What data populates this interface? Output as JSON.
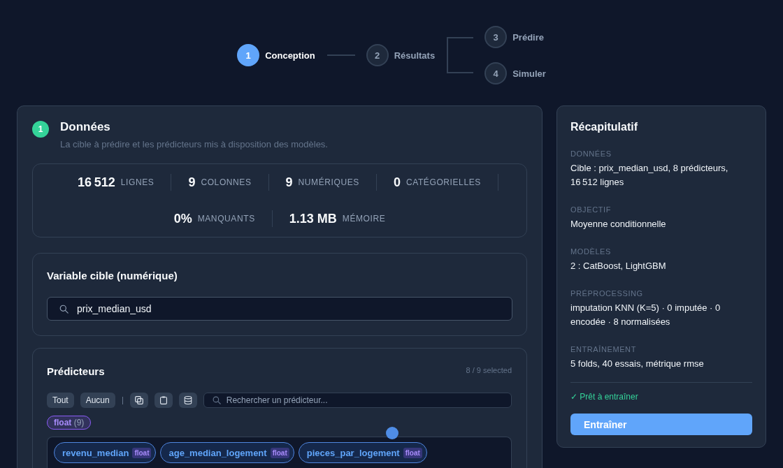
{
  "stepper": {
    "steps": [
      {
        "number": "1",
        "label": "Conception",
        "selected": true
      },
      {
        "number": "2",
        "label": "Résultats",
        "selected": false
      }
    ],
    "branch_steps": [
      {
        "number": "3",
        "label": "Prédire",
        "selected": false
      },
      {
        "number": "4",
        "label": "Simuler",
        "selected": false
      }
    ]
  },
  "data_card": {
    "step": "1",
    "title": "Données",
    "subtitle": "La cible à prédire et les prédicteurs mis à disposition des modèles.",
    "stats": [
      {
        "value": "16 512",
        "label": "LIGNES"
      },
      {
        "value": "9",
        "label": "COLONNES"
      },
      {
        "value": "9",
        "label": "NUMÉRIQUES"
      },
      {
        "value": "0",
        "label": "CATÉGORIELLES"
      },
      {
        "value": "0%",
        "label": "MANQUANTS"
      },
      {
        "value": "1.13 MB",
        "label": "MÉMOIRE"
      }
    ],
    "target": {
      "title": "Variable cible (numérique)",
      "value": "prix_median_usd"
    },
    "predictors": {
      "title": "Prédicteurs",
      "count": "8 / 9 selected",
      "buttons": [
        "Tout",
        "Aucun"
      ],
      "search": {
        "placeholder": "Rechercher un prédicteur..."
      },
      "type_filters": [
        {
          "label": "float",
          "count": "(9)",
          "selected": true
        }
      ],
      "chips": [
        {
          "name": "revenu_median",
          "type": "float",
          "selected": true
        },
        {
          "name": "age_median_logement",
          "type": "float",
          "selected": true
        },
        {
          "name": "pieces_par_logement",
          "type": "float",
          "selected": true
        }
      ]
    }
  },
  "summary": {
    "title": "Récapitulatif",
    "sections": [
      {
        "label": "DONNÉES",
        "value": "Cible : prix_median_usd, 8 prédicteurs, 16 512 lignes"
      },
      {
        "label": "OBJECTIF",
        "value": "Moyenne conditionnelle"
      },
      {
        "label": "MODÈLES",
        "value": "2 : CatBoost, LightGBM"
      },
      {
        "label": "PRÉPROCESSING",
        "value": "imputation KNN (K=5) · 0 imputée · 0 encodée · 8 normalisées"
      },
      {
        "label": "ENTRAÎNEMENT",
        "value": "5 folds, 40 essais, métrique rmse"
      }
    ],
    "status": "✓ Prêt à entraîner",
    "button": "Entraîner"
  }
}
